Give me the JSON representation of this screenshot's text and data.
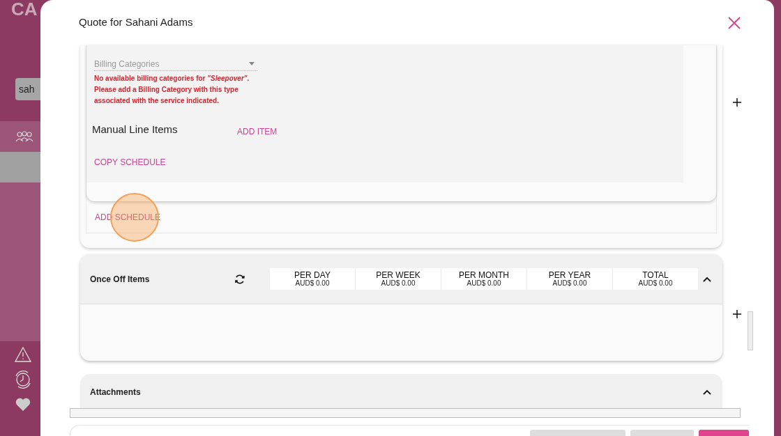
{
  "app_background": {
    "logo_text": "CA",
    "search": {
      "value": "sah"
    },
    "nav_items": [
      {
        "kind": "people",
        "selected": false
      },
      {
        "kind": "blank",
        "selected": true
      }
    ],
    "bottom_icons": [
      {
        "kind": "warning"
      },
      {
        "kind": "clock"
      },
      {
        "kind": "heart"
      }
    ]
  },
  "modal": {
    "title": "Quote for Sahani Adams",
    "schedule": {
      "billing_select": {
        "placeholder": "Billing Categories"
      },
      "error": "No available billing categories for *\"Sleepover\"*. Please add a Billing Category with this type associated with the service indicated.",
      "manual_line_items": "Manual Line Items",
      "add_item": "ADD ITEM",
      "copy_schedule": "COPY SCHEDULE",
      "add_schedule": "ADD SCHEDULE",
      "tap_indicator": true
    },
    "once_off": {
      "title": "Once Off Items",
      "expanded": true,
      "summary": [
        {
          "label": "PER DAY",
          "value": "AUD$ 0.00"
        },
        {
          "label": "PER WEEK",
          "value": "AUD$ 0.00"
        },
        {
          "label": "PER MONTH",
          "value": "AUD$ 0.00"
        },
        {
          "label": "PER YEAR",
          "value": "AUD$ 0.00"
        },
        {
          "label": "TOTAL",
          "value": "AUD$ 0.00"
        }
      ]
    },
    "attachments": {
      "title": "Attachments",
      "expanded": true
    },
    "footer": {
      "buttons": [
        {
          "kind": "secondary"
        },
        {
          "kind": "secondary"
        },
        {
          "kind": "primary"
        }
      ]
    }
  }
}
